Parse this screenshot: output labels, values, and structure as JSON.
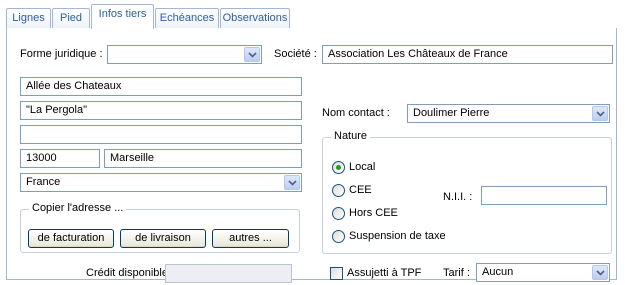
{
  "tabs": [
    "Lignes",
    "Pied",
    "Infos tiers",
    "Echéances",
    "Observations"
  ],
  "forme_juridique": {
    "label": "Forme juridique :",
    "value": ""
  },
  "societe": {
    "label": "Société :",
    "value": "Association Les Châteaux de France"
  },
  "adresse": {
    "ligne1": "Allée des Chateaux",
    "ligne2": "\"La Pergola\"",
    "ligne3": "",
    "code_postal": "13000",
    "ville": "Marseille",
    "pays": "France"
  },
  "copier": {
    "title": "Copier l'adresse ...",
    "facturation": "de facturation",
    "livraison": "de livraison",
    "autres": "autres ..."
  },
  "credit": {
    "label": "Crédit disponible :",
    "value": ""
  },
  "contact": {
    "label": "Nom contact :",
    "value": "Doulimer Pierre"
  },
  "nature": {
    "title": "Nature",
    "options": [
      "Local",
      "CEE",
      "Hors CEE",
      "Suspension de taxe"
    ],
    "selected": "Local",
    "nii_label": "N.I.I. :",
    "nii_value": ""
  },
  "tpf": {
    "label": "Assujetti à TPF",
    "checked": false
  },
  "tarif": {
    "label": "Tarif :",
    "value": "Aucun"
  },
  "colors": {
    "accent": "#2b5fa6",
    "border": "#7f9db9",
    "radio_dot": "#21a121"
  }
}
